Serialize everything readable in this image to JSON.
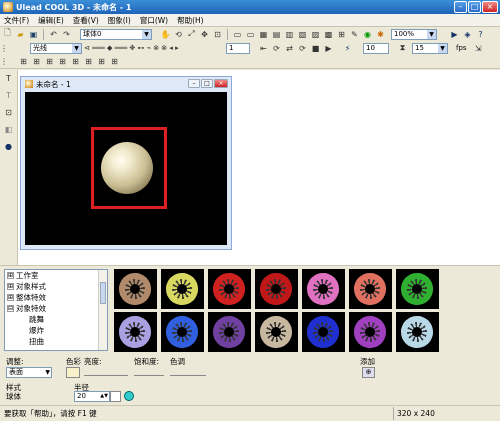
{
  "window": {
    "title": "Ulead COOL 3D - 未命名 - 1"
  },
  "menu": [
    "文件(F)",
    "编辑(E)",
    "查看(V)",
    "图象(I)",
    "窗口(W)",
    "帮助(H)"
  ],
  "toolbar": {
    "object_select": "球体0",
    "zoom": "100%",
    "light_select": "光线",
    "frame_value": "1",
    "frame_count": "10",
    "fps_value": "15",
    "fps_label": "fps"
  },
  "document": {
    "title": "未命名 - 1"
  },
  "tree": {
    "items": [
      {
        "label": "工作室",
        "expander": "⊞"
      },
      {
        "label": "对象样式",
        "expander": "⊞"
      },
      {
        "label": "整体特效",
        "expander": "⊞"
      },
      {
        "label": "对象特效",
        "expander": "⊟"
      }
    ],
    "children": [
      "跳舞",
      "爆炸",
      "扭曲"
    ]
  },
  "gallery": {
    "colors": [
      "#b08a6a",
      "#d8d860",
      "#d02020",
      "#c01818",
      "#e070c0",
      "#e07060",
      "#30b030",
      "#a8a0e0",
      "#3060e0",
      "#7040a0",
      "#c8b8a0",
      "#2030d0",
      "#a040c0",
      "#b8d8e8"
    ]
  },
  "properties": {
    "adjust_label": "调整:",
    "adjust_value": "表面",
    "color_label": "色彩",
    "brightness_label": "亮度:",
    "saturation_label": "饱和度:",
    "hue_label": "色调",
    "add_label": "添加",
    "style_label": "样式",
    "style_value": "球体",
    "radius_label": "半径",
    "radius_value": "20"
  },
  "status": {
    "help_text": "要获取「帮助」，请按 F1 键",
    "resolution": "320 x 240"
  }
}
